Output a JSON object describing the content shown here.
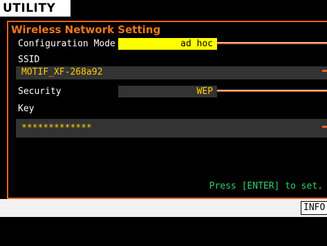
{
  "screen": {
    "tab_label": "UTILITY"
  },
  "panel": {
    "title": "Wireless Network Setting",
    "config_mode": {
      "label": "Configuration Mode",
      "value": "ad hoc"
    },
    "ssid": {
      "label": "SSID",
      "value": "MOTIF_XF-268a92"
    },
    "security": {
      "label": "Security",
      "value": "WEP"
    },
    "key": {
      "label": "Key",
      "value": "*************"
    },
    "hint": "Press [ENTER] to set."
  },
  "bottom": {
    "info_button": "INFO"
  },
  "colors": {
    "accent": "#e8641f",
    "title": "#f0781e",
    "highlight": "#ffff00",
    "value_text": "#ffcc00",
    "hint_text": "#31d36b",
    "field_bg": "#333333"
  }
}
